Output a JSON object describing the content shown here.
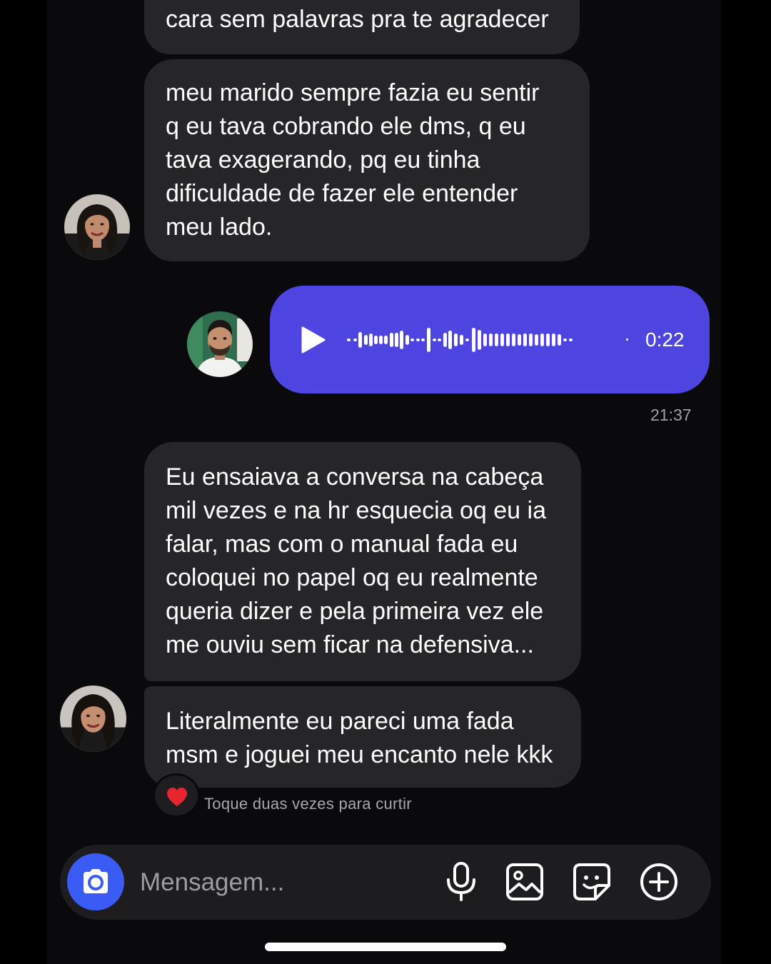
{
  "colors": {
    "incoming_bubble": "#262629",
    "voice_bubble": "#4e44e0",
    "camera_button": "#3b5bf5",
    "heart": "#e8252f"
  },
  "messages": [
    {
      "id": "m1",
      "text": "cara sem palavras pra te agradecer"
    },
    {
      "id": "m2",
      "text": "meu marido sempre fazia eu sentir\nq eu tava cobrando ele dms, q eu\ntava exagerando, pq eu tinha\ndificuldade de fazer ele entender\nmeu lado."
    },
    {
      "id": "m3",
      "text": "Eu ensaiava a conversa na cabeça\nmil vezes e na hr esquecia oq eu ia\nfalar, mas com o manual fada eu\ncoloquei no papel oq eu realmente\nqueria dizer e pela primeira vez ele\nme ouviu sem ficar na defensiva..."
    },
    {
      "id": "m4",
      "text": "Literalmente eu pareci uma fada\nmsm e joguei meu encanto nele kkk"
    }
  ],
  "voice_message": {
    "icon": "play-icon",
    "duration": "0:22",
    "timestamp": "21:37"
  },
  "reaction": {
    "icon": "heart-icon"
  },
  "like_hint": "Toque duas vezes para curtir",
  "composer": {
    "placeholder": "Mensagem...",
    "icons": [
      "camera-icon",
      "microphone-icon",
      "gallery-icon",
      "sticker-icon",
      "plus-icon"
    ]
  }
}
